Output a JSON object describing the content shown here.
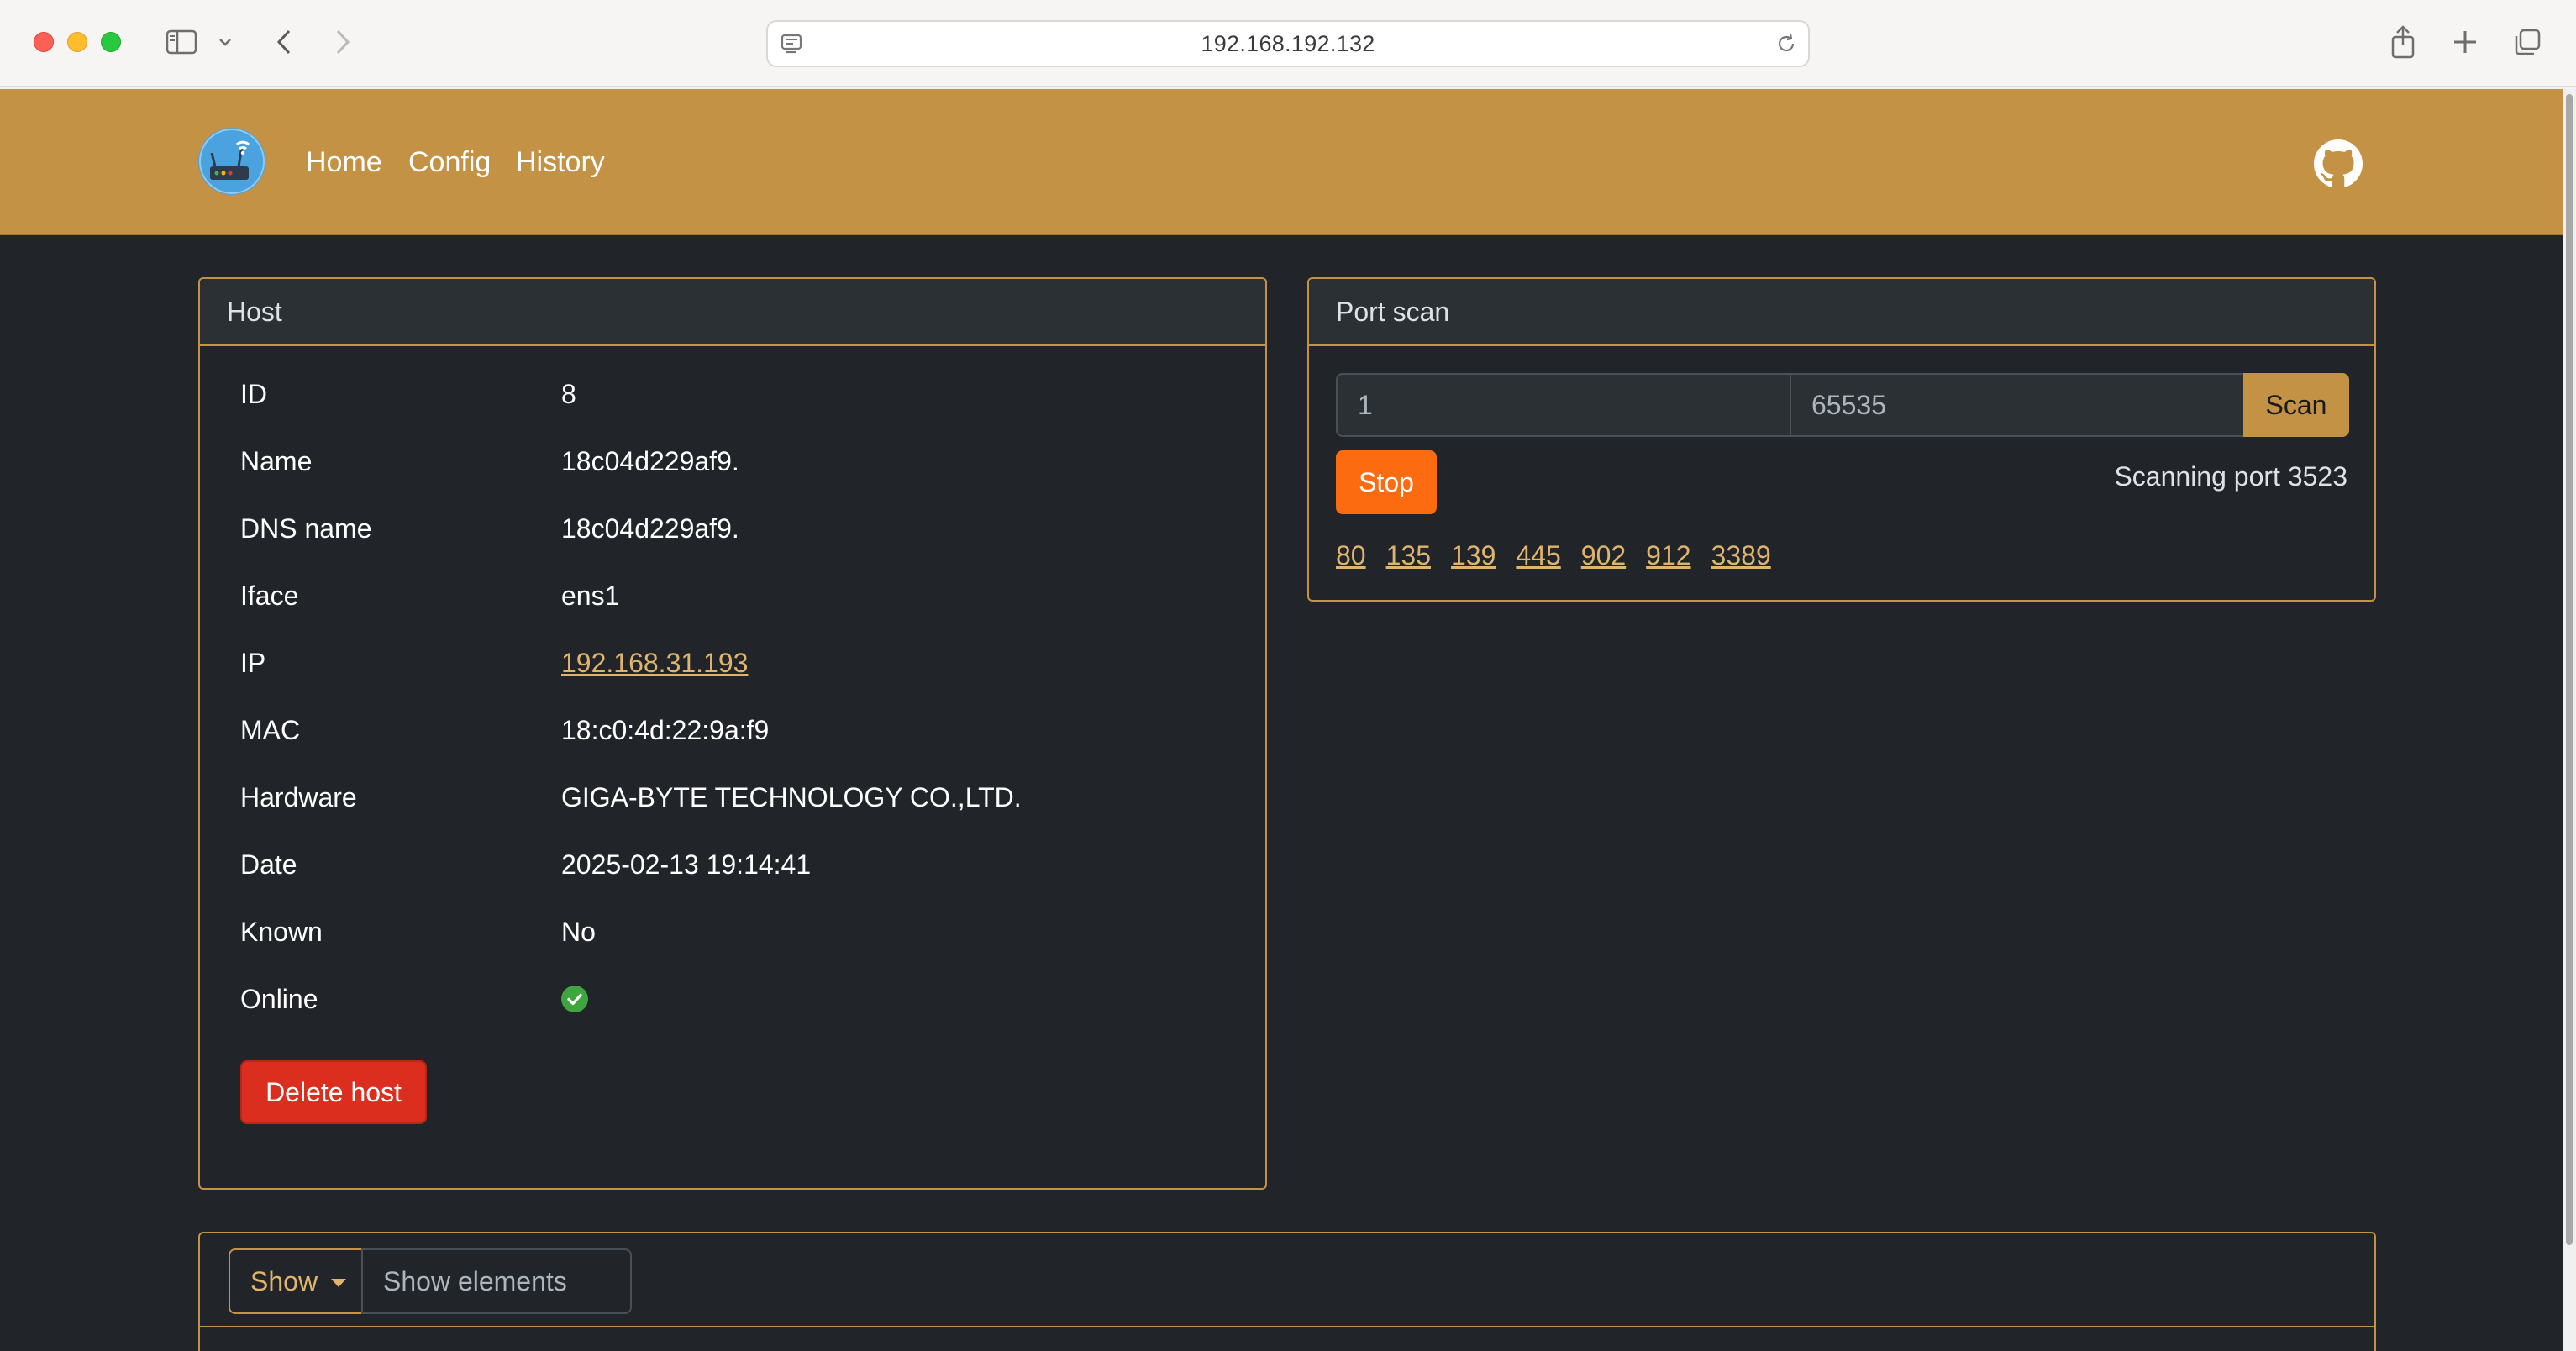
{
  "browser": {
    "url": "192.168.192.132"
  },
  "navbar": {
    "links": [
      "Home",
      "Config",
      "History"
    ]
  },
  "host": {
    "title": "Host",
    "fields": [
      {
        "label": "ID",
        "value": "8"
      },
      {
        "label": "Name",
        "value": "18c04d229af9."
      },
      {
        "label": "DNS name",
        "value": "18c04d229af9."
      },
      {
        "label": "Iface",
        "value": "ens1"
      },
      {
        "label": "IP",
        "value": "192.168.31.193"
      },
      {
        "label": "MAC",
        "value": "18:c0:4d:22:9a:f9"
      },
      {
        "label": "Hardware",
        "value": "GIGA-BYTE TECHNOLOGY CO.,LTD."
      },
      {
        "label": "Date",
        "value": "2025-02-13 19:14:41"
      },
      {
        "label": "Known",
        "value": "No"
      },
      {
        "label": "Online",
        "value": ""
      }
    ],
    "delete_label": "Delete host"
  },
  "port_scan": {
    "title": "Port scan",
    "from_value": "1",
    "to_placeholder": "65535",
    "scan_label": "Scan",
    "stop_label": "Stop",
    "status": "Scanning port 3523",
    "ports": [
      "80",
      "135",
      "139",
      "445",
      "902",
      "912",
      "3389"
    ]
  },
  "elements": {
    "dropdown_label": "Show",
    "placeholder": "Show elements"
  },
  "colors": {
    "accent": "#c49244",
    "background": "#212529",
    "danger": "#dc2e1e",
    "warning": "#fd6b10",
    "online": "#3fa63f"
  }
}
